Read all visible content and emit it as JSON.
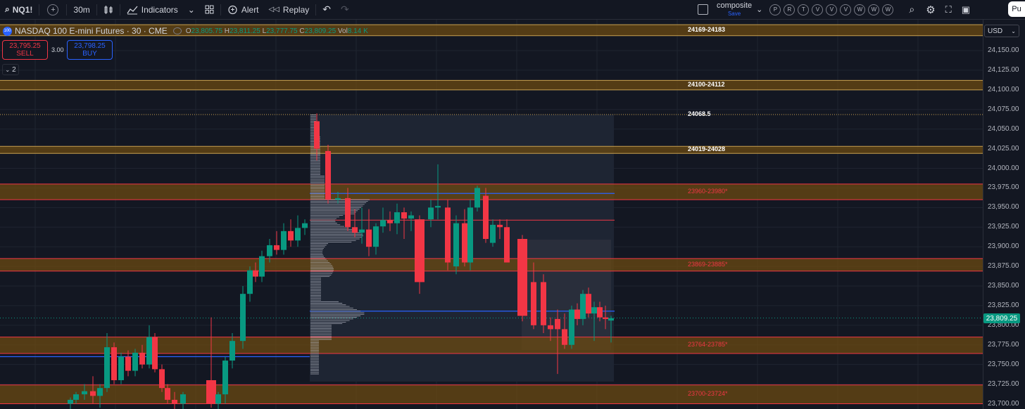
{
  "toolbar": {
    "symbol": "NQ1!",
    "interval": "30m",
    "indicators_label": "Indicators",
    "alert_label": "Alert",
    "replay_label": "Replay",
    "layout_name": "composite",
    "layout_status": "Save",
    "account_circles": [
      "P",
      "R",
      "T",
      "V",
      "V",
      "V",
      "W",
      "W",
      "W"
    ],
    "publish_label": "Pu"
  },
  "legend": {
    "title": "NASDAQ 100 E-mini Futures · 30 · CME",
    "logo_text": "100",
    "open_label": "O",
    "open": "23,805.75",
    "high_label": "H",
    "high": "23,811.25",
    "low_label": "L",
    "low": "23,777.75",
    "close_label": "C",
    "close": "23,809.25",
    "vol_label": "Vol",
    "vol": "8.14 K"
  },
  "trade": {
    "sell_price": "23,795.25",
    "sell_label": "SELL",
    "spread": "3.00",
    "buy_price": "23,798.25",
    "buy_label": "BUY"
  },
  "indicators_collapsed_count": "2",
  "price_axis": {
    "currency": "USD",
    "current_price": "23,809.25",
    "ticks": [
      "24,150.00",
      "24,125.00",
      "24,100.00",
      "24,075.00",
      "24,050.00",
      "24,025.00",
      "24,000.00",
      "23,975.00",
      "23,950.00",
      "23,925.00",
      "23,900.00",
      "23,875.00",
      "23,850.00",
      "23,825.00",
      "23,800.00",
      "23,775.00",
      "23,750.00",
      "23,725.00",
      "23,700.00"
    ]
  },
  "zones": [
    {
      "label": "24169-24183",
      "lo": 24169,
      "hi": 24183,
      "style": "white"
    },
    {
      "label": "24100-24112",
      "lo": 24100,
      "hi": 24112,
      "style": "white"
    },
    {
      "label": "24019-24028",
      "lo": 24019,
      "hi": 24028,
      "style": "white"
    },
    {
      "label": "23960-23980*",
      "lo": 23960,
      "hi": 23980,
      "style": "red"
    },
    {
      "label": "23869-23885*",
      "lo": 23869,
      "hi": 23885,
      "style": "red"
    },
    {
      "label": "23764-23785*",
      "lo": 23764,
      "hi": 23785,
      "style": "red"
    },
    {
      "label": "23700-23724*",
      "lo": 23700,
      "hi": 23724,
      "style": "red"
    }
  ],
  "level_label": "24068.5",
  "colors": {
    "up": "#089981",
    "down": "#f23645",
    "zone_fill": "#6b4a12",
    "zone_border_white": "#c8a050",
    "zone_border_red": "#f23645",
    "blue_line": "#2962ff",
    "background": "#131722"
  }
}
